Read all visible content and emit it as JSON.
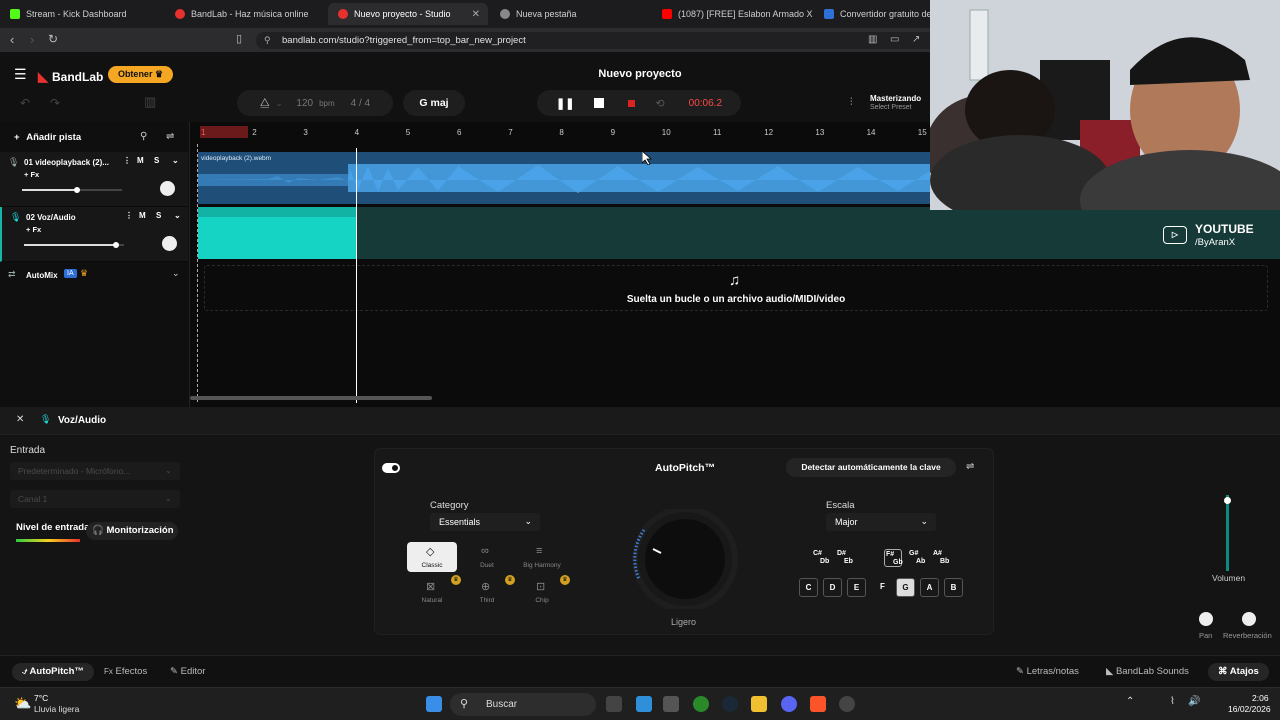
{
  "browser": {
    "tabs": [
      {
        "title": "Stream - Kick Dashboard",
        "color": "#53fc18"
      },
      {
        "title": "BandLab - Haz música online",
        "color": "#e8312f"
      },
      {
        "title": "Nuevo proyecto - Studio",
        "color": "#e8312f",
        "active": true
      },
      {
        "title": "Nueva pestaña",
        "color": "#cccccc"
      },
      {
        "title": "(1087) [FREE] Eslabon Armado X Dan",
        "color": "#ff0000"
      },
      {
        "title": "Convertidor gratuito de Vi",
        "color": "#2f6fd8"
      }
    ],
    "url": "bandlab.com/studio?triggered_from=top_bar_new_project"
  },
  "app": {
    "logo": "BandLab",
    "get_label": "Obtener",
    "project_title": "Nuevo proyecto",
    "bpm_value": "120",
    "bpm_unit": "bpm",
    "time_signature": "4 / 4",
    "key": "G maj",
    "time": "00:06.2",
    "mastering_title": "Masterizando",
    "mastering_sub": "Select Preset"
  },
  "tracks": {
    "add_label": "Añadir pista",
    "items": [
      {
        "name": "01  videoplayback (2)...",
        "fx": "+ Fx",
        "mute": "M",
        "solo": "S",
        "volume": 0.55
      },
      {
        "name": "02  Voz/Audio",
        "fx": "+ Fx",
        "mute": "M",
        "solo": "S",
        "volume": 0.92
      }
    ],
    "automix_label": "AutoMix",
    "automix_badge": "IA",
    "clip1_label": "videoplayback (2).webm"
  },
  "ruler": [
    "1",
    "2",
    "3",
    "4",
    "5",
    "6",
    "7",
    "8",
    "9",
    "10",
    "11",
    "12",
    "13",
    "14",
    "15"
  ],
  "dropzone_text": "Suelta un bucle o un archivo audio/MIDI/video",
  "panel": {
    "track_label": "Voz/Audio",
    "entrada_label": "Entrada",
    "input_device": "Predeterminado - Micrófono...",
    "channel": "Canal 1",
    "input_level_label": "Nivel de entrada",
    "monitor_label": "Monitorización",
    "autopitch_title": "AutoPitch™",
    "detect_label": "Detectar automáticamente la clave",
    "category_label": "Category",
    "category_value": "Essentials",
    "presets": [
      {
        "label": "Classic",
        "icon": "◇"
      },
      {
        "label": "Duet",
        "icon": "∞"
      },
      {
        "label": "Big Harmony",
        "icon": "≡"
      },
      {
        "label": "Natural",
        "icon": "⊠"
      },
      {
        "label": "Third",
        "icon": "⊕"
      },
      {
        "label": "Chip",
        "icon": "⊡"
      }
    ],
    "knob_label": "Ligero",
    "scale_label": "Escala",
    "scale_value": "Major",
    "sharps": [
      {
        "top": "C#",
        "bottom": "Db"
      },
      {
        "top": "D#",
        "bottom": "Eb"
      },
      {
        "top": "F#",
        "bottom": "Gb"
      },
      {
        "top": "G#",
        "bottom": "Ab"
      },
      {
        "top": "A#",
        "bottom": "Bb"
      }
    ],
    "naturals": [
      "C",
      "D",
      "E",
      "F",
      "G",
      "A",
      "B"
    ],
    "volume_label": "Volumen",
    "pan_label": "Pan",
    "reverb_label": "Reverberación"
  },
  "bottom_tabs": {
    "autopitch": "AutoPitch™",
    "effects": "Efectos",
    "editor": "Editor",
    "lyrics": "Letras/notas",
    "sounds": "BandLab Sounds",
    "shortcuts": "Atajos"
  },
  "overlay": {
    "youtube_title": "YOUTUBE",
    "youtube_handle": "/ByAranX"
  },
  "taskbar": {
    "temp": "7°C",
    "weather": "Lluvia ligera",
    "search": "Buscar",
    "time": "2:06",
    "date": "16/02/2026"
  }
}
